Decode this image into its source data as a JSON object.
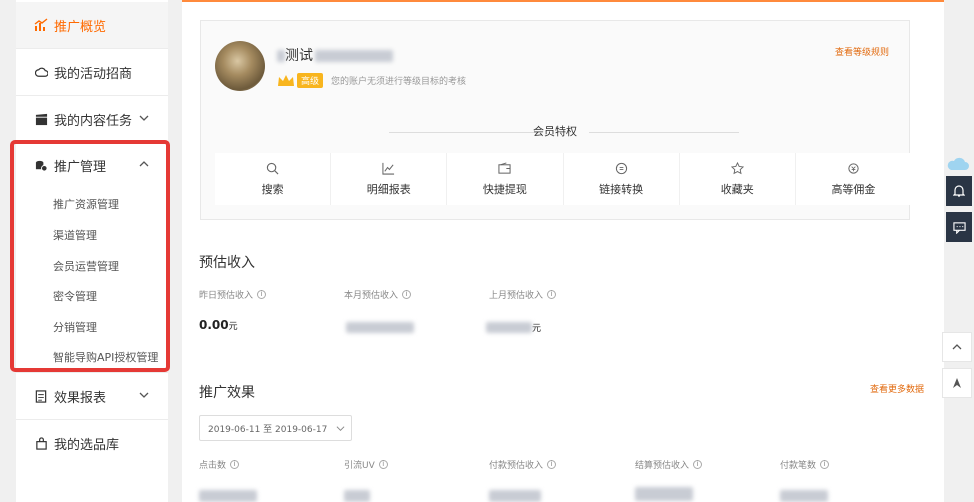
{
  "sidebar": {
    "items": [
      {
        "label": "推广概览",
        "icon": "chart-icon",
        "active": true
      },
      {
        "label": "我的活动招商",
        "icon": "cloud-icon"
      },
      {
        "label": "我的内容任务",
        "icon": "clapper-icon"
      },
      {
        "label": "推广管理",
        "icon": "coins-icon",
        "expanded": true
      },
      {
        "label": "效果报表",
        "icon": "report-icon"
      },
      {
        "label": "我的选品库",
        "icon": "bag-icon"
      }
    ],
    "submenu": [
      "推广资源管理",
      "渠道管理",
      "会员运营管理",
      "密令管理",
      "分销管理",
      "智能导购API授权管理"
    ],
    "accent": "#ff6a00",
    "highlight_color": "#e53935"
  },
  "profile": {
    "name_visible": "测试",
    "level_badge": "高级",
    "level_note": "您的账户无须进行等级目标的考核",
    "view_rules": "查看等级规则"
  },
  "member": {
    "title": "会员特权",
    "features": [
      {
        "label": "搜索",
        "icon": "search-icon"
      },
      {
        "label": "明细报表",
        "icon": "line-chart-icon"
      },
      {
        "label": "快捷提现",
        "icon": "wallet-icon"
      },
      {
        "label": "链接转换",
        "icon": "link-convert-icon"
      },
      {
        "label": "收藏夹",
        "icon": "star-icon"
      },
      {
        "label": "高等佣金",
        "icon": "money-bag-icon"
      }
    ]
  },
  "income": {
    "title": "预估收入",
    "metrics": [
      {
        "label": "昨日预估收入",
        "value": "0.00",
        "unit": "元"
      },
      {
        "label": "本月预估收入",
        "value": "",
        "unit": ""
      },
      {
        "label": "上月预估收入",
        "value": "",
        "unit": "元"
      }
    ]
  },
  "effect": {
    "title": "推广效果",
    "more": "查看更多数据",
    "date_range": "2019-06-11 至 2019-06-17",
    "metrics": [
      {
        "label": "点击数"
      },
      {
        "label": "引流UV"
      },
      {
        "label": "付款预估收入"
      },
      {
        "label": "结算预估收入"
      },
      {
        "label": "付款笔数"
      }
    ]
  },
  "tools": [
    "bell-icon",
    "chat-icon",
    "arrow-up-icon",
    "paper-plane-icon"
  ]
}
